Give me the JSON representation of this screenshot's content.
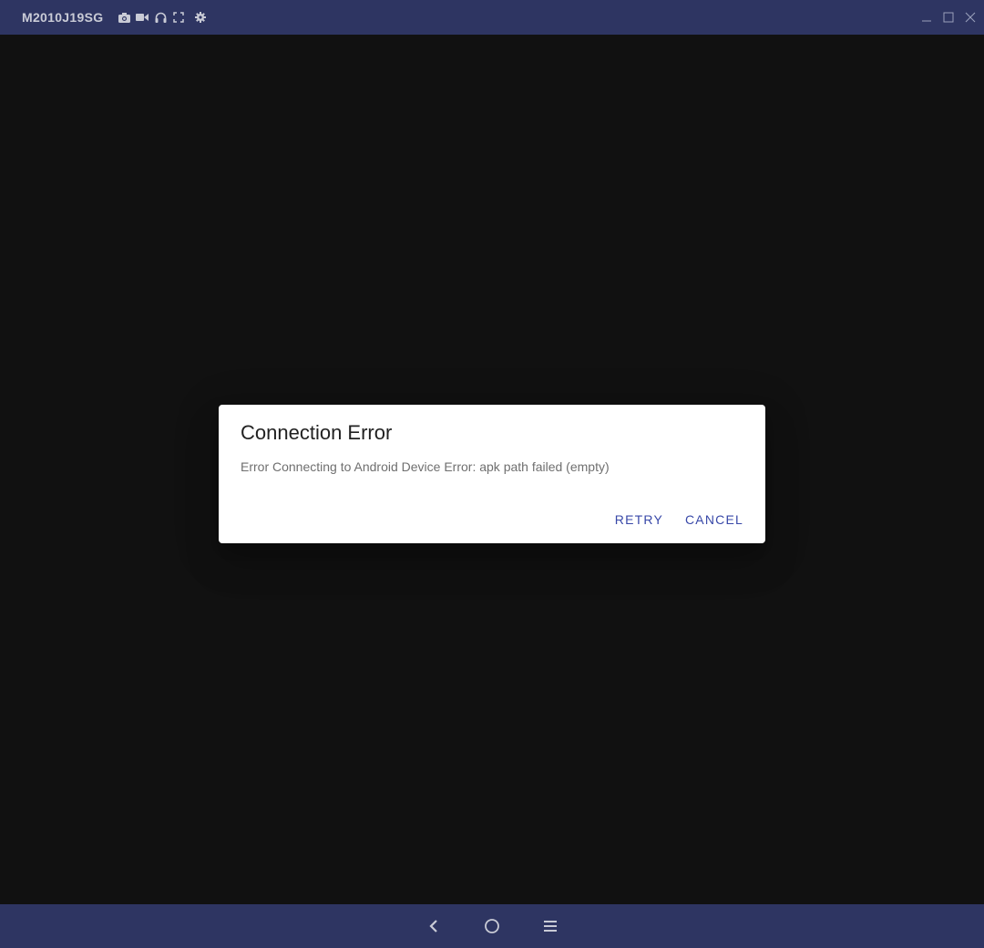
{
  "window": {
    "device_name": "M2010J19SG",
    "toolbar_icons": [
      "camera-icon",
      "video-icon",
      "headphones-icon",
      "fullscreen-icon",
      "settings-icon"
    ],
    "controls": [
      "minimize-icon",
      "maximize-icon",
      "close-icon"
    ]
  },
  "dialog": {
    "title": "Connection Error",
    "message": "Error Connecting to Android Device Error: apk path failed (empty)",
    "retry_label": "RETRY",
    "cancel_label": "CANCEL"
  },
  "navbar": {
    "buttons": [
      "back-icon",
      "home-icon",
      "menu-icon"
    ]
  },
  "colors": {
    "titlebar": "#2e3562",
    "screen": "#111111",
    "accent": "#3848a8"
  }
}
